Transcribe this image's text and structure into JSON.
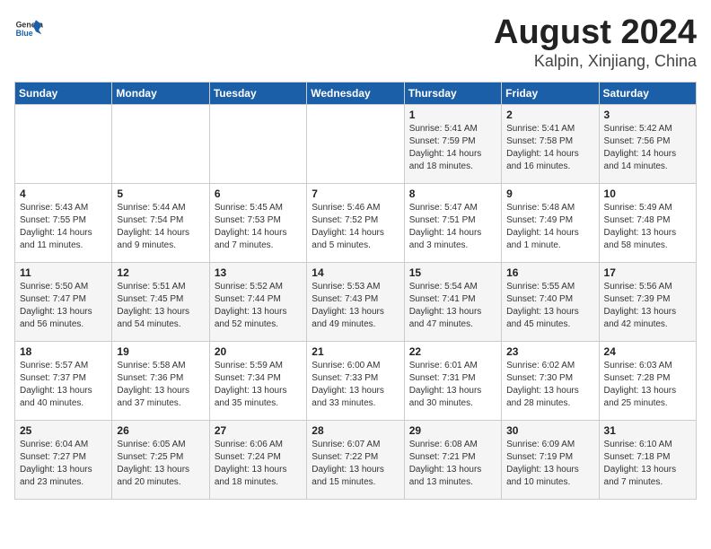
{
  "logo": {
    "general": "General",
    "blue": "Blue"
  },
  "title": "August 2024",
  "subtitle": "Kalpin, Xinjiang, China",
  "days_of_week": [
    "Sunday",
    "Monday",
    "Tuesday",
    "Wednesday",
    "Thursday",
    "Friday",
    "Saturday"
  ],
  "weeks": [
    [
      {
        "day": "",
        "info": ""
      },
      {
        "day": "",
        "info": ""
      },
      {
        "day": "",
        "info": ""
      },
      {
        "day": "",
        "info": ""
      },
      {
        "day": "1",
        "info": "Sunrise: 5:41 AM\nSunset: 7:59 PM\nDaylight: 14 hours\nand 18 minutes."
      },
      {
        "day": "2",
        "info": "Sunrise: 5:41 AM\nSunset: 7:58 PM\nDaylight: 14 hours\nand 16 minutes."
      },
      {
        "day": "3",
        "info": "Sunrise: 5:42 AM\nSunset: 7:56 PM\nDaylight: 14 hours\nand 14 minutes."
      }
    ],
    [
      {
        "day": "4",
        "info": "Sunrise: 5:43 AM\nSunset: 7:55 PM\nDaylight: 14 hours\nand 11 minutes."
      },
      {
        "day": "5",
        "info": "Sunrise: 5:44 AM\nSunset: 7:54 PM\nDaylight: 14 hours\nand 9 minutes."
      },
      {
        "day": "6",
        "info": "Sunrise: 5:45 AM\nSunset: 7:53 PM\nDaylight: 14 hours\nand 7 minutes."
      },
      {
        "day": "7",
        "info": "Sunrise: 5:46 AM\nSunset: 7:52 PM\nDaylight: 14 hours\nand 5 minutes."
      },
      {
        "day": "8",
        "info": "Sunrise: 5:47 AM\nSunset: 7:51 PM\nDaylight: 14 hours\nand 3 minutes."
      },
      {
        "day": "9",
        "info": "Sunrise: 5:48 AM\nSunset: 7:49 PM\nDaylight: 14 hours\nand 1 minute."
      },
      {
        "day": "10",
        "info": "Sunrise: 5:49 AM\nSunset: 7:48 PM\nDaylight: 13 hours\nand 58 minutes."
      }
    ],
    [
      {
        "day": "11",
        "info": "Sunrise: 5:50 AM\nSunset: 7:47 PM\nDaylight: 13 hours\nand 56 minutes."
      },
      {
        "day": "12",
        "info": "Sunrise: 5:51 AM\nSunset: 7:45 PM\nDaylight: 13 hours\nand 54 minutes."
      },
      {
        "day": "13",
        "info": "Sunrise: 5:52 AM\nSunset: 7:44 PM\nDaylight: 13 hours\nand 52 minutes."
      },
      {
        "day": "14",
        "info": "Sunrise: 5:53 AM\nSunset: 7:43 PM\nDaylight: 13 hours\nand 49 minutes."
      },
      {
        "day": "15",
        "info": "Sunrise: 5:54 AM\nSunset: 7:41 PM\nDaylight: 13 hours\nand 47 minutes."
      },
      {
        "day": "16",
        "info": "Sunrise: 5:55 AM\nSunset: 7:40 PM\nDaylight: 13 hours\nand 45 minutes."
      },
      {
        "day": "17",
        "info": "Sunrise: 5:56 AM\nSunset: 7:39 PM\nDaylight: 13 hours\nand 42 minutes."
      }
    ],
    [
      {
        "day": "18",
        "info": "Sunrise: 5:57 AM\nSunset: 7:37 PM\nDaylight: 13 hours\nand 40 minutes."
      },
      {
        "day": "19",
        "info": "Sunrise: 5:58 AM\nSunset: 7:36 PM\nDaylight: 13 hours\nand 37 minutes."
      },
      {
        "day": "20",
        "info": "Sunrise: 5:59 AM\nSunset: 7:34 PM\nDaylight: 13 hours\nand 35 minutes."
      },
      {
        "day": "21",
        "info": "Sunrise: 6:00 AM\nSunset: 7:33 PM\nDaylight: 13 hours\nand 33 minutes."
      },
      {
        "day": "22",
        "info": "Sunrise: 6:01 AM\nSunset: 7:31 PM\nDaylight: 13 hours\nand 30 minutes."
      },
      {
        "day": "23",
        "info": "Sunrise: 6:02 AM\nSunset: 7:30 PM\nDaylight: 13 hours\nand 28 minutes."
      },
      {
        "day": "24",
        "info": "Sunrise: 6:03 AM\nSunset: 7:28 PM\nDaylight: 13 hours\nand 25 minutes."
      }
    ],
    [
      {
        "day": "25",
        "info": "Sunrise: 6:04 AM\nSunset: 7:27 PM\nDaylight: 13 hours\nand 23 minutes."
      },
      {
        "day": "26",
        "info": "Sunrise: 6:05 AM\nSunset: 7:25 PM\nDaylight: 13 hours\nand 20 minutes."
      },
      {
        "day": "27",
        "info": "Sunrise: 6:06 AM\nSunset: 7:24 PM\nDaylight: 13 hours\nand 18 minutes."
      },
      {
        "day": "28",
        "info": "Sunrise: 6:07 AM\nSunset: 7:22 PM\nDaylight: 13 hours\nand 15 minutes."
      },
      {
        "day": "29",
        "info": "Sunrise: 6:08 AM\nSunset: 7:21 PM\nDaylight: 13 hours\nand 13 minutes."
      },
      {
        "day": "30",
        "info": "Sunrise: 6:09 AM\nSunset: 7:19 PM\nDaylight: 13 hours\nand 10 minutes."
      },
      {
        "day": "31",
        "info": "Sunrise: 6:10 AM\nSunset: 7:18 PM\nDaylight: 13 hours\nand 7 minutes."
      }
    ]
  ]
}
